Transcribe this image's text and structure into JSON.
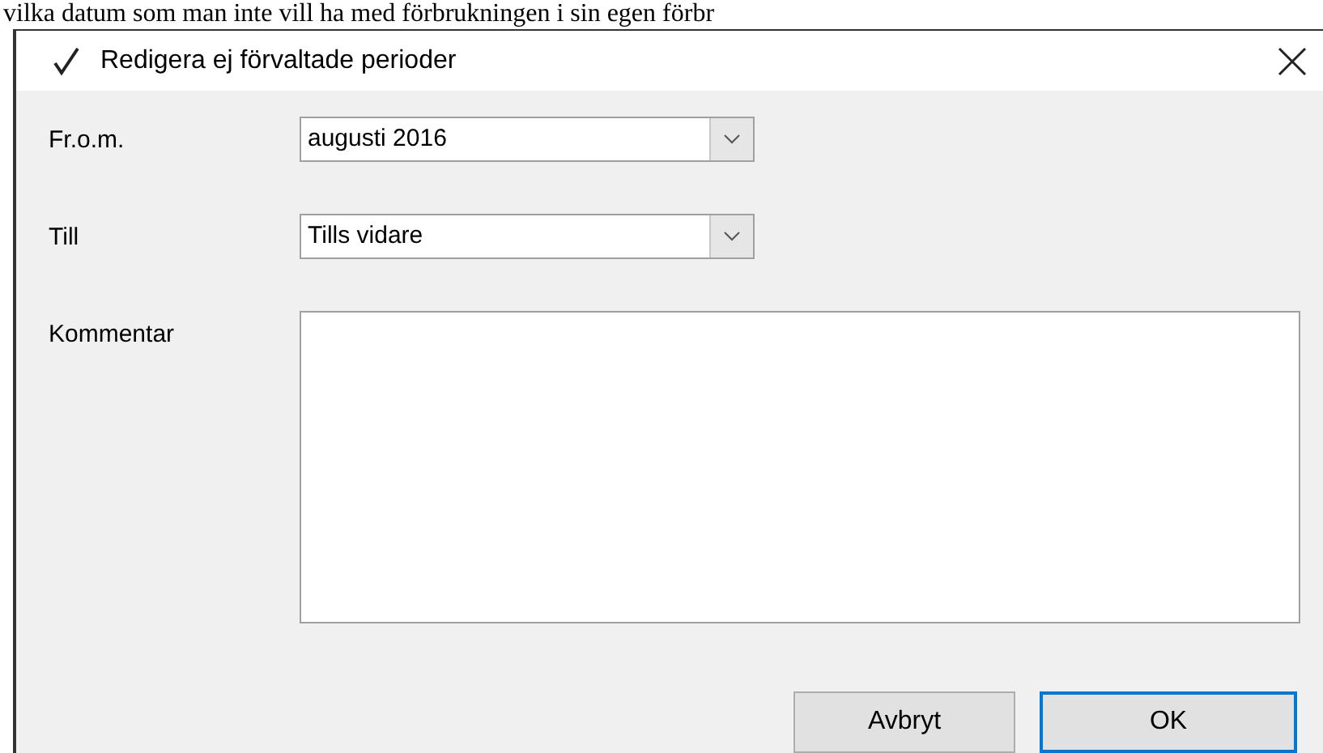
{
  "background_text": "vilka datum som man inte vill ha med förbrukningen i sin egen förbr",
  "window": {
    "title": "Redigera ej förvaltade perioder"
  },
  "fields": [
    {
      "label": "Fr.o.m.",
      "kind": "combo",
      "value": "augusti 2016"
    },
    {
      "label": "Till",
      "kind": "combo",
      "value": "Tills vidare"
    },
    {
      "label": "Kommentar",
      "kind": "textarea"
    }
  ],
  "buttons": [
    {
      "label": "Avbryt",
      "default": false
    },
    {
      "label": "OK",
      "default": true
    }
  ]
}
